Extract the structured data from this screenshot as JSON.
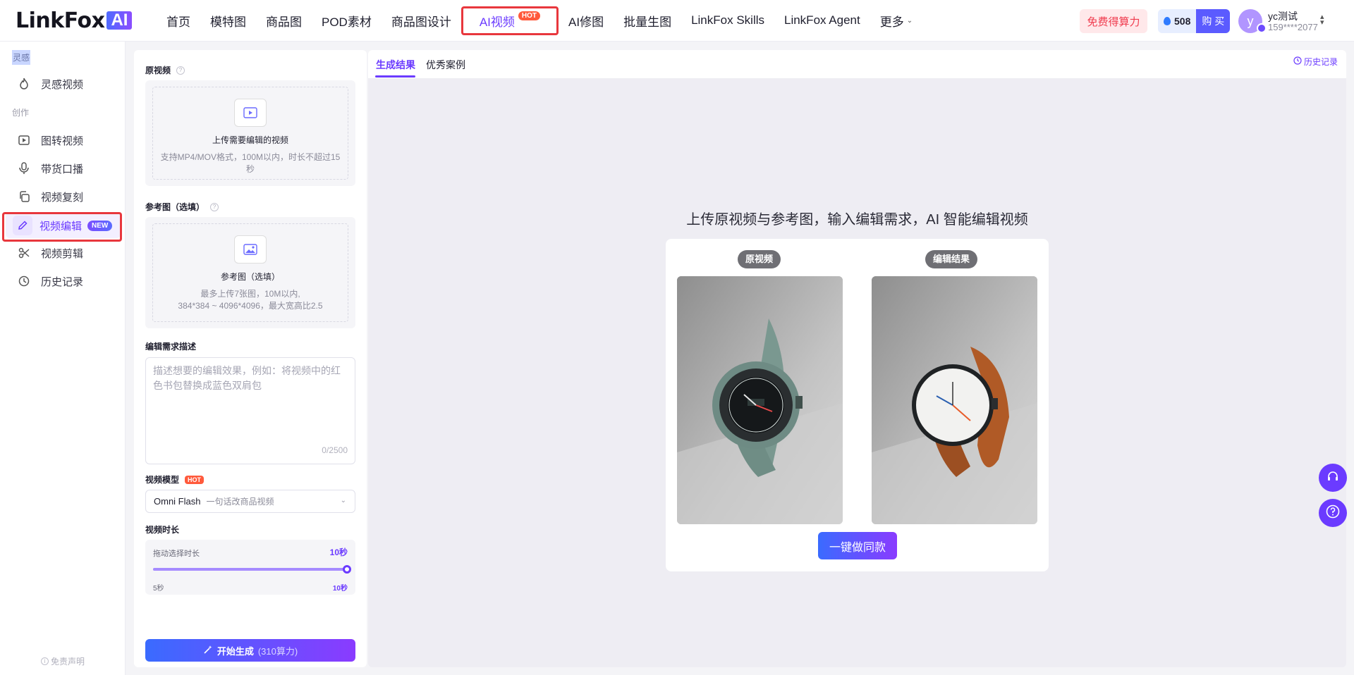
{
  "brand": {
    "name": "LinkFox",
    "badge": "AI"
  },
  "nav": {
    "items": [
      "首页",
      "模特图",
      "商品图",
      "POD素材",
      "商品图设计",
      "AI视频",
      "AI修图",
      "批量生图",
      "LinkFox Skills",
      "LinkFox Agent",
      "更多"
    ],
    "hot_badge": "HOT"
  },
  "header": {
    "free_credits": "免费得算力",
    "credits": "508",
    "buy": "购 买",
    "user_initial": "y",
    "user_name": "yc测试",
    "user_phone": "159****2077"
  },
  "sidebar": {
    "section_inspiration": "灵感",
    "item_inspiration": "灵感视频",
    "section_create": "创作",
    "items": [
      "图转视频",
      "带货口播",
      "视频复刻",
      "视频编辑",
      "视频剪辑",
      "历史记录"
    ],
    "new_badge": "NEW",
    "disclaimer": "免责声明"
  },
  "form": {
    "source_label": "原视频",
    "source_title": "上传需要编辑的视频",
    "source_desc": "支持MP4/MOV格式，100M以内，时长不超过15秒",
    "ref_label": "参考图（选填）",
    "ref_title": "参考图（选填）",
    "ref_desc_1": "最多上传7张图，10M以内,",
    "ref_desc_2": "384*384 ~ 4096*4096，最大宽高比2.5",
    "prompt_label": "编辑需求描述",
    "prompt_placeholder": "描述想要的编辑效果，例如：将视频中的红色书包替换成蓝色双肩包",
    "prompt_counter": "0/2500",
    "model_label": "视频模型",
    "model_badge": "HOT",
    "model_value": "Omni Flash",
    "model_sub": "一句话改商品视频",
    "duration_label": "视频时长",
    "duration_hint": "拖动选择时长",
    "duration_value": "10秒",
    "duration_fraction": 1.0,
    "duration_min": "5秒",
    "duration_max": "10秒",
    "generate_label": "开始生成",
    "generate_cost": "(310算力)"
  },
  "main": {
    "tabs": [
      "生成结果",
      "优秀案例"
    ],
    "history": "历史记录",
    "headline": "上传原视频与参考图，输入编辑需求，AI 智能编辑视频",
    "before_label": "原视频",
    "after_label": "编辑结果",
    "action": "一键做同款"
  },
  "colors": {
    "accent": "#6b3bff",
    "highlight": "#e8373d",
    "hot": "#ff5a3c"
  }
}
